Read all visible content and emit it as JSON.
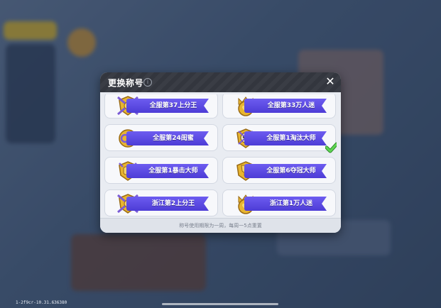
{
  "dialog": {
    "title": "更换称号",
    "close_label": "✕",
    "footer_note": "称号使用期限为一周，每周一5点重置"
  },
  "titles": [
    {
      "label": "全服第37上分王",
      "emblem": "shield-swords-emblem",
      "selected": false
    },
    {
      "label": "全服第33万人迷",
      "emblem": "crown-heart-emblem",
      "selected": false
    },
    {
      "label": "全服第24闺蜜",
      "emblem": "ring-emblem",
      "selected": false
    },
    {
      "label": "全服第1淘汰大师",
      "emblem": "skull-emblem",
      "selected": true
    },
    {
      "label": "全服第1暴击大师",
      "emblem": "fist-emblem",
      "selected": false
    },
    {
      "label": "全服第6夺冠大师",
      "emblem": "trophy-emblem",
      "selected": false
    },
    {
      "label": "浙江第2上分王",
      "emblem": "shield-swords-emblem",
      "selected": false
    },
    {
      "label": "浙江第1万人迷",
      "emblem": "crown-heart-emblem",
      "selected": false
    }
  ],
  "version": "1-2f9cr-10.31.636380",
  "colors": {
    "ribbon": "#5a49e2",
    "check": "#4fc447",
    "emblem_gold": "#e8b530"
  }
}
